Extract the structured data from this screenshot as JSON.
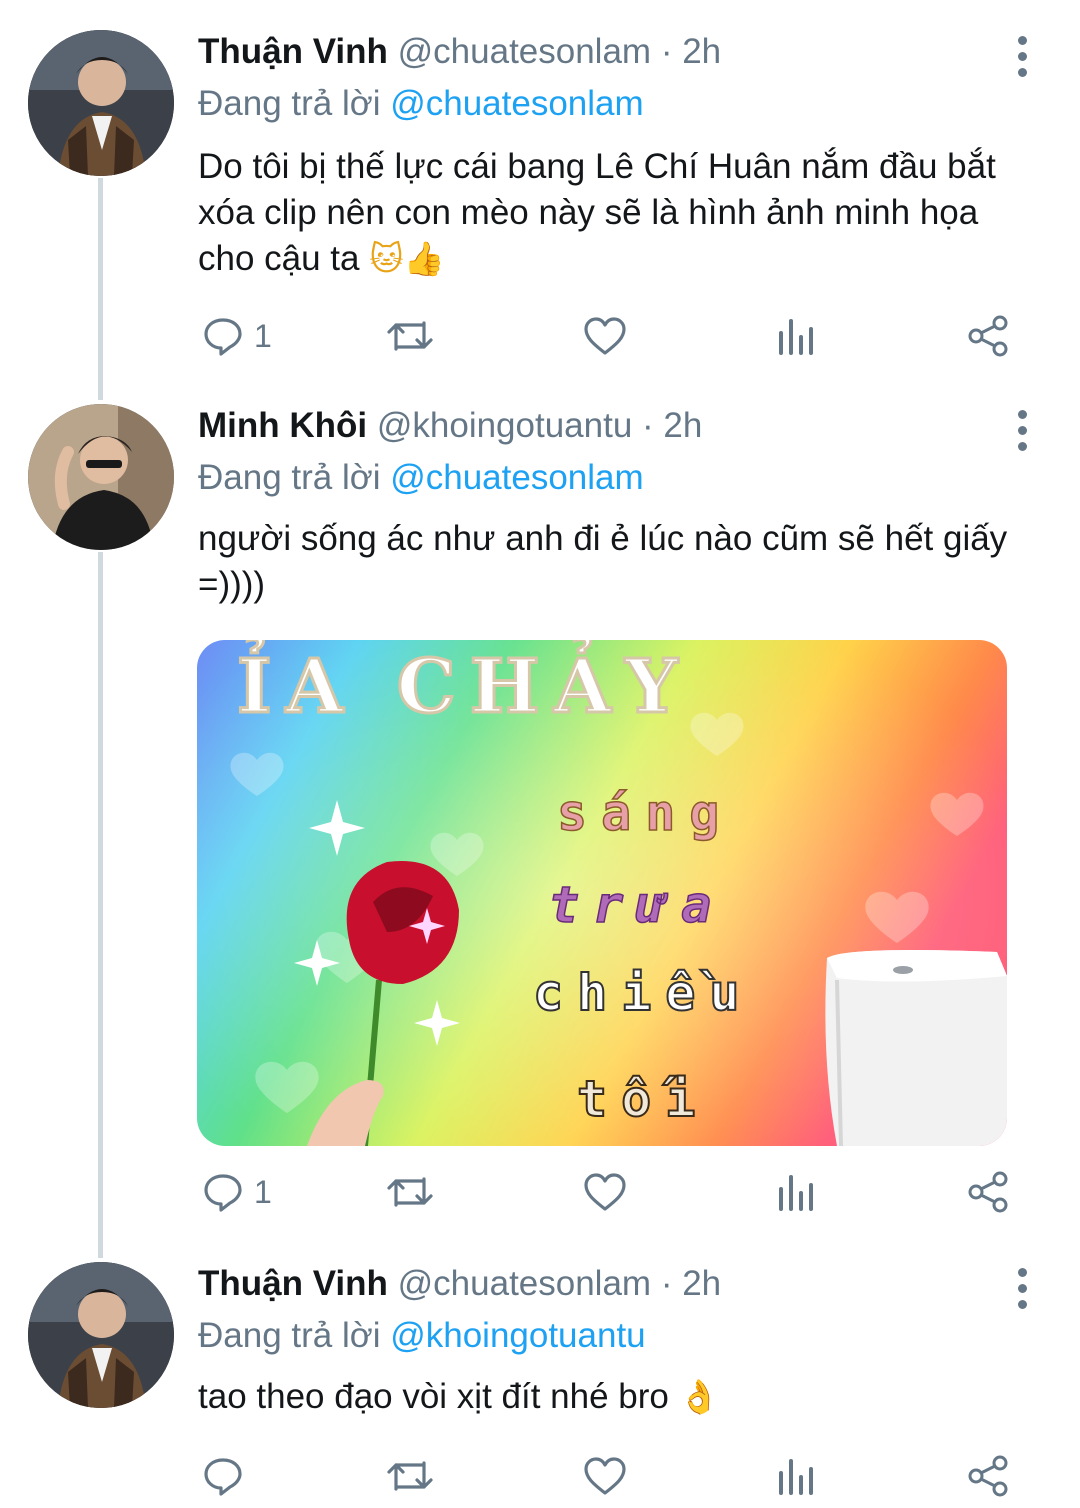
{
  "colors": {
    "background": "#ffffff",
    "text": "#14171a",
    "muted": "#657786",
    "link": "#1da1f2",
    "thread_line": "#cfd9de"
  },
  "tweets": [
    {
      "name": "Thuận Vinh",
      "handle": "@chuatesonlam",
      "time": "· 2h",
      "replying_label": "Đang trả lời",
      "replying_to": "@chuatesonlam",
      "text": "Do tôi bị thế lực cái bang Lê Chí Huân nắm đầu bắt xóa clip nên con mèo này sẽ là hình ảnh minh họa cho cậu ta",
      "emojis": [
        "cat-face",
        "thumbs-up"
      ],
      "reply_count": "1",
      "avatar_icon": "avatar-photo"
    },
    {
      "name": "Minh Khôi",
      "handle": "@khoingotuantu",
      "time": "· 2h",
      "replying_label": "Đang trả lời",
      "replying_to": "@chuatesonlam",
      "text": "người sống ác như anh đi ẻ lúc nào cũm sẽ hết giấy =))))",
      "reply_count": "1",
      "avatar_icon": "avatar-photo",
      "media": {
        "title": "ỈA CHẢY",
        "lines": [
          "sáng",
          "trưa",
          "chiều",
          "tối"
        ],
        "icon": "meme-image"
      }
    },
    {
      "name": "Thuận Vinh",
      "handle": "@chuatesonlam",
      "time": "· 2h",
      "replying_label": "Đang trả lời",
      "replying_to": "@khoingotuantu",
      "text": "tao theo đạo vòi xịt đít nhé bro",
      "emojis": [
        "ok-hand"
      ],
      "reply_count": "",
      "avatar_icon": "avatar-photo"
    }
  ]
}
